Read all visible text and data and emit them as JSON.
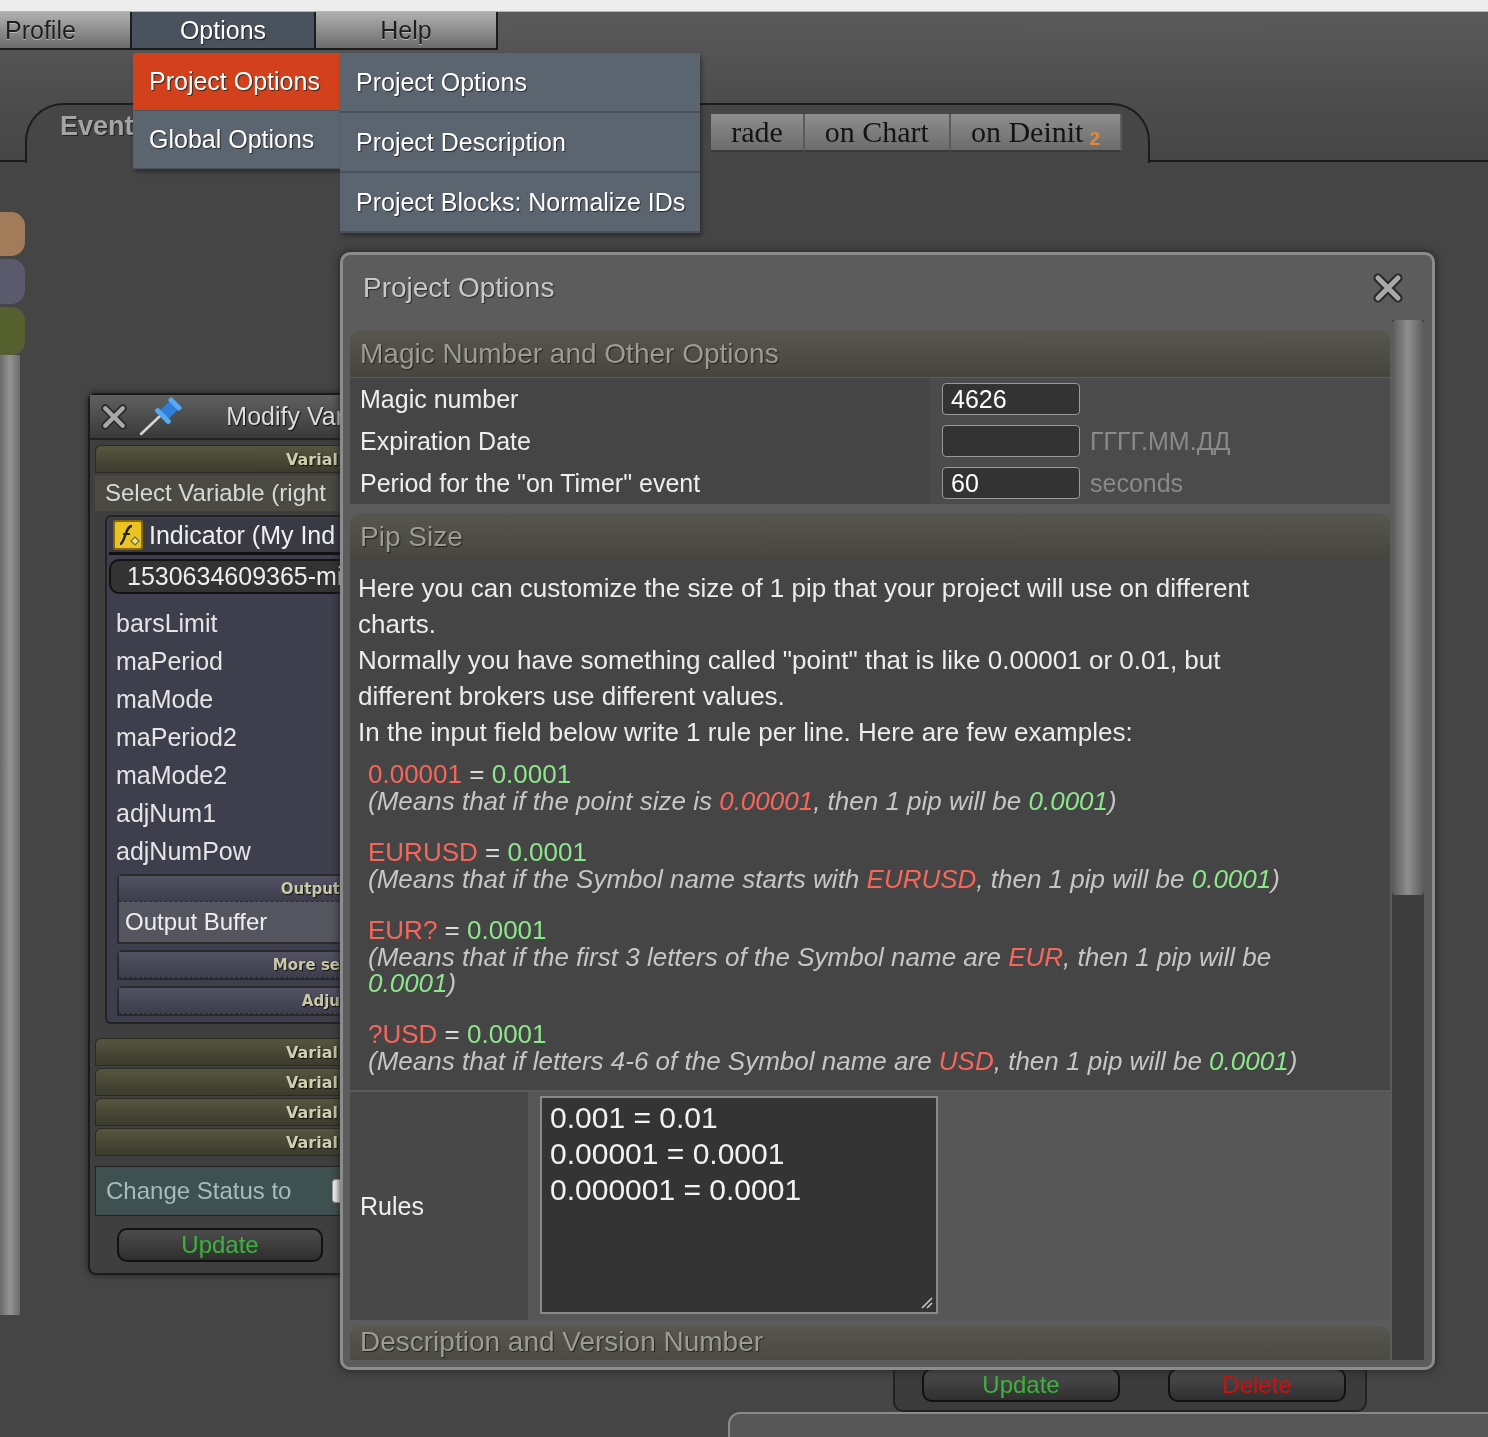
{
  "menu_bar": [
    {
      "label": "Profile",
      "selected": false
    },
    {
      "label": "Options",
      "selected": true
    },
    {
      "label": "Help",
      "selected": false
    }
  ],
  "dropdown": [
    {
      "label": "Project Options",
      "selected": true
    },
    {
      "label": "Global Options",
      "selected": false
    }
  ],
  "submenu": [
    "Project Options",
    "Project Description",
    "Project Blocks: Normalize IDs"
  ],
  "event_tabs": {
    "label": "Event",
    "tabs": [
      {
        "label": "rade",
        "selected": false
      },
      {
        "label": "on Chart",
        "selected": false
      },
      {
        "label": "on Deinit",
        "selected": false,
        "badge": "2"
      }
    ]
  },
  "side_tabs": [
    {
      "color": "#a27c5a"
    },
    {
      "color": "#5a5a6c"
    },
    {
      "color": "#56602e"
    }
  ],
  "variable_window": {
    "title": "Modify Var",
    "section_header": "Varial",
    "prompt": "Select Variable (right",
    "indicator": "Indicator (My Ind",
    "id_field": "1530634609365-mi",
    "variables": [
      "barsLimit",
      "maPeriod",
      "maMode",
      "maPeriod2",
      "maMode2",
      "adjNum1",
      "adjNumPow"
    ],
    "subsections": [
      {
        "header": "Output",
        "items": [
          "Output Buffer"
        ]
      },
      {
        "header": "More se"
      },
      {
        "header": "Adju"
      }
    ],
    "collapsed_headers": [
      "Varial",
      "Varial",
      "Varial",
      "Varial"
    ],
    "status": {
      "label": "Change Status to",
      "checked": false
    },
    "update_button": "Update"
  },
  "dialog": {
    "title": "Project Options",
    "sections": [
      {
        "kind": "form",
        "title": "Magic Number and Other Options",
        "rows": [
          {
            "label": "Magic number",
            "value": "4626"
          },
          {
            "label": "Expiration Date",
            "suffix": "ГГГГ.ММ.ДД"
          },
          {
            "label": "Period for the \"on Timer\" event",
            "value": "60",
            "suffix": "seconds"
          }
        ]
      },
      {
        "kind": "pip",
        "title": "Pip Size",
        "intro": [
          "Here you can customize the size of 1 pip that your project will use on different charts.",
          "Normally you have something called \"point\" that is like 0.00001 or 0.01, but different brokers use different values.",
          "In the input field below write 1 rule per line. Here are few examples:"
        ],
        "examples": [
          {
            "rule": [
              {
                "kind": "pattern",
                "text": "0.00001"
              },
              {
                "kind": "plain",
                "text": " = "
              },
              {
                "kind": "pip",
                "text": "0.0001"
              }
            ],
            "note": [
              {
                "kind": "plain",
                "text": "(Means that if the point size is "
              },
              {
                "kind": "pattern",
                "text": "0.00001"
              },
              {
                "kind": "plain",
                "text": ", then 1 pip will be "
              },
              {
                "kind": "pip",
                "text": "0.0001"
              },
              {
                "kind": "plain",
                "text": ")"
              }
            ]
          },
          {
            "rule": [
              {
                "kind": "pattern",
                "text": "EURUSD"
              },
              {
                "kind": "plain",
                "text": " = "
              },
              {
                "kind": "pip",
                "text": "0.0001"
              }
            ],
            "note": [
              {
                "kind": "plain",
                "text": "(Means that if the Symbol name starts with "
              },
              {
                "kind": "pattern",
                "text": "EURUSD"
              },
              {
                "kind": "plain",
                "text": ", then 1 pip will be "
              },
              {
                "kind": "pip",
                "text": "0.0001"
              },
              {
                "kind": "plain",
                "text": ")"
              }
            ]
          },
          {
            "rule": [
              {
                "kind": "pattern",
                "text": "EUR?"
              },
              {
                "kind": "plain",
                "text": " = "
              },
              {
                "kind": "pip",
                "text": "0.0001"
              }
            ],
            "note": [
              {
                "kind": "plain",
                "text": "(Means that if the first 3 letters of the Symbol name are "
              },
              {
                "kind": "pattern",
                "text": "EUR"
              },
              {
                "kind": "plain",
                "text": ", then 1 pip will be "
              },
              {
                "kind": "pip",
                "text": "0.0001"
              },
              {
                "kind": "plain",
                "text": ")"
              }
            ]
          },
          {
            "rule": [
              {
                "kind": "pattern",
                "text": "?USD"
              },
              {
                "kind": "plain",
                "text": " = "
              },
              {
                "kind": "pip",
                "text": "0.0001"
              }
            ],
            "note": [
              {
                "kind": "plain",
                "text": "(Means that if letters 4-6 of the Symbol name are "
              },
              {
                "kind": "pattern",
                "text": "USD"
              },
              {
                "kind": "plain",
                "text": ", then 1 pip will be "
              },
              {
                "kind": "pip",
                "text": "0.0001"
              },
              {
                "kind": "plain",
                "text": ")"
              }
            ]
          }
        ],
        "rules": {
          "label": "Rules",
          "value": "0.001 = 0.01\n0.00001 = 0.0001\n0.000001 = 0.0001"
        }
      },
      {
        "kind": "collapsed",
        "title": "Description and Version Number"
      }
    ]
  },
  "dialog_buttons": [
    {
      "label": "Update",
      "kind": "update"
    },
    {
      "label": "Delete",
      "kind": "delete"
    }
  ]
}
